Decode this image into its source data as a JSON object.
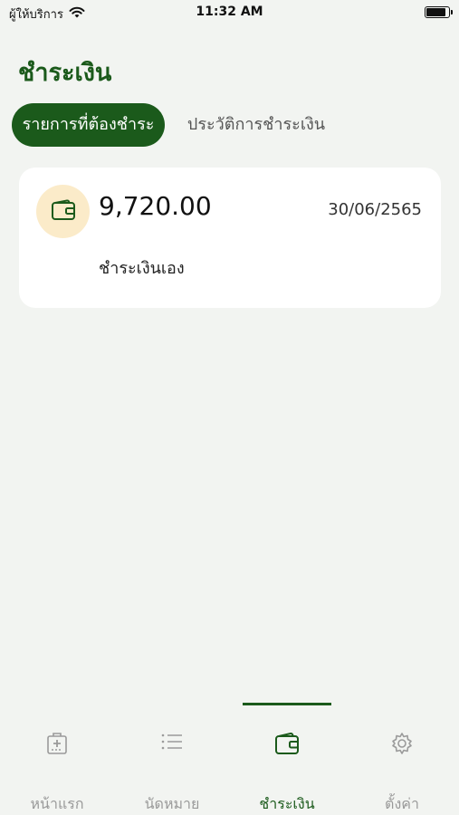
{
  "status_bar": {
    "carrier": "ผู้ให้บริการ",
    "time": "11:32 AM",
    "battery_level": 0.9
  },
  "page": {
    "title": "ชำระเงิน"
  },
  "tabs": [
    {
      "label": "รายการที่ต้องชำระ",
      "active": true
    },
    {
      "label": "ประวัติการชำระเงิน",
      "active": false
    }
  ],
  "bills": [
    {
      "icon": "wallet-icon",
      "amount": "9,720.00",
      "due_date": "30/06/2565",
      "method": "ชำระเงินเอง"
    }
  ],
  "bottom_nav": [
    {
      "label": "หน้าแรก",
      "icon": "hospital-icon",
      "active": false
    },
    {
      "label": "นัดหมาย",
      "icon": "list-icon",
      "active": false
    },
    {
      "label": "ชำระเงิน",
      "icon": "wallet-icon",
      "active": true
    },
    {
      "label": "ตั้งค่า",
      "icon": "gear-icon",
      "active": false
    }
  ],
  "colors": {
    "primary": "#1b5a1b",
    "background": "#f2f4f1",
    "icon_badge": "#fbebc9",
    "inactive": "#999999"
  }
}
